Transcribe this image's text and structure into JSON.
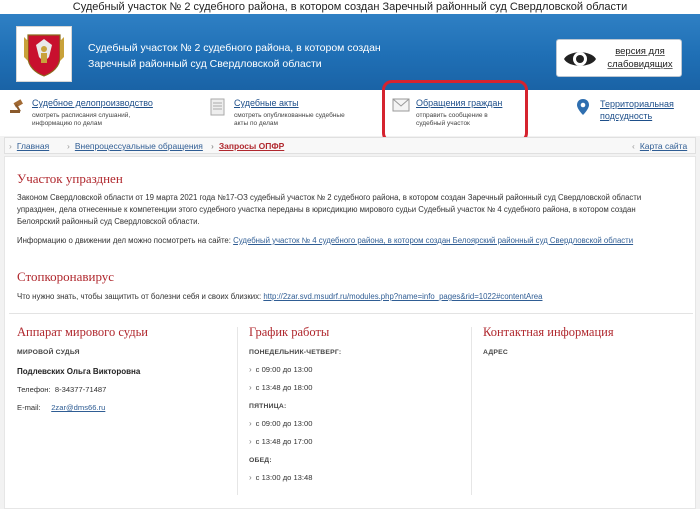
{
  "window_title": "Судебный участок № 2 судебного района, в котором создан Заречный районный суд Свердловской области",
  "header": {
    "title_line1": "Судебный участок № 2 судебного района, в котором создан",
    "title_line2": "Заречный районный суд Свердловской области",
    "vision_line1": "версия для",
    "vision_line2": "слабовидящих"
  },
  "services": [
    {
      "title": "Судебное делопроизводство",
      "desc": "смотреть расписания слушаний, информацию по делам",
      "icon": "gavel-icon"
    },
    {
      "title": "Судебные акты",
      "desc": "смотреть опубликованные судебные акты по делам",
      "icon": "document-icon"
    },
    {
      "title": "Обращения граждан",
      "desc": "отправить сообщение в судебный участок",
      "icon": "envelope-icon"
    },
    {
      "title": "Территориальная подсудность",
      "desc": "",
      "icon": "map-pin-icon"
    }
  ],
  "breadcrumbs": {
    "home": "Главная",
    "item2": "Внепроцессуальные обращения",
    "current": "Запросы ОПФР",
    "sitemap": "Карта сайта"
  },
  "notice": {
    "heading": "Участок упразднен",
    "text": "Законом Свердловской области от 19 марта 2021 года №17-ОЗ судебный участок № 2 судебного района, в котором создан Заречный районный суд Свердловской области упразднен, дела отнесенные к компетенции этого судебного участка переданы в юрисдикцию мирового судьи Судебный участок № 4 судебного района, в котором создан Белоярский районный суд Свердловской области.",
    "info_prefix": "Информацию о движении дел можно посмотреть на сайте:",
    "info_link": "Судебный участок № 4 судебного района, в котором создан Белоярский районный суд Свердловской области"
  },
  "covid": {
    "heading": "Стопкоронавирус",
    "prefix": "Что нужно знать, чтобы защитить от болезни себя и своих близких:",
    "link": "http://2zar.svd.msudrf.ru/modules.php?name=info_pages&rid=1022#contentArea"
  },
  "judge": {
    "heading": "Аппарат мирового судьи",
    "role": "МИРОВОЙ СУДЬЯ",
    "name": "Подлевских Ольга Викторовна",
    "phone_label": "Телефон:",
    "phone": "8-34377-71487",
    "email_label": "E-mail:",
    "email": "2zar@dms66.ru"
  },
  "schedule": {
    "heading": "График работы",
    "g1_label": "ПОНЕДЕЛЬНИК-ЧЕТВЕРГ:",
    "g1_t1": "с 09:00 до 13:00",
    "g1_t2": "с 13:48 до 18:00",
    "g2_label": "ПЯТНИЦА:",
    "g2_t1": "с 09:00 до 13:00",
    "g2_t2": "с 13:48 до 17:00",
    "g3_label": "ОБЕД:",
    "g3_t1": "с 13:00 до 13:48"
  },
  "contacts": {
    "heading": "Контактная информация",
    "address_label": "АДРЕС"
  },
  "colors": {
    "accent_red": "#b0282e",
    "header_blue": "#1f6fb5",
    "link_blue": "#2f5d94",
    "highlight": "#d5232f"
  }
}
